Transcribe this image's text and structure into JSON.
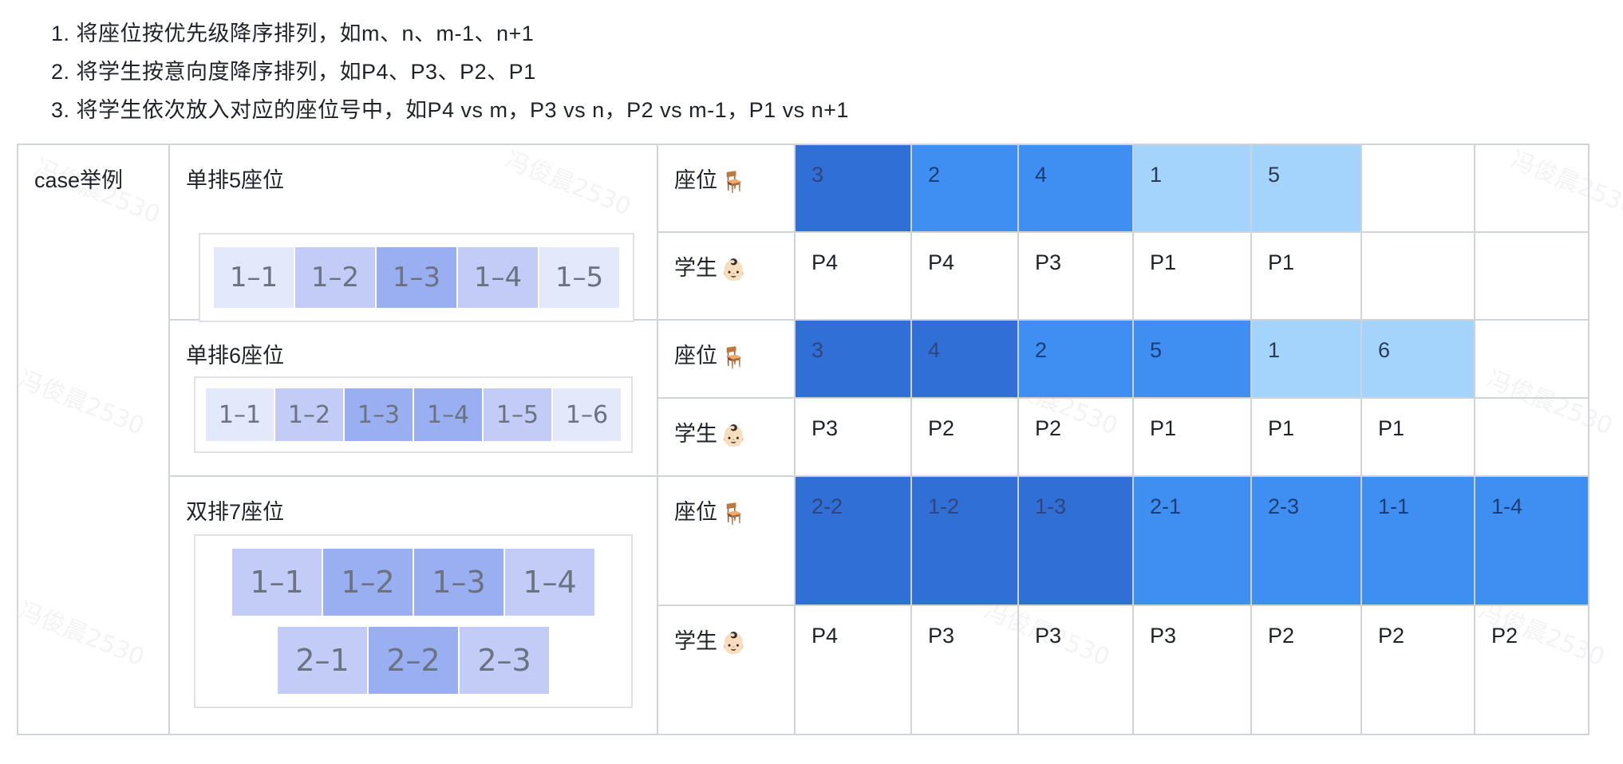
{
  "steps": [
    "1. 将座位按优先级降序排列，如m、n、m-1、n+1",
    "2. 将学生按意向度降序排列，如P4、P3、P2、P1",
    "3. 将学生依次放入对应的座位号中，如P4 vs m，P3 vs n，P2 vs m-1，P1 vs n+1"
  ],
  "watermark": "冯俊晨2530",
  "row_header": "case举例",
  "seat_label": "座位",
  "student_label": "学生",
  "seat_emoji": "🪑",
  "student_emoji": "👶🏻",
  "colors": {
    "seat_deep": "#2f6fd6",
    "seat_mid": "#3f8ff2",
    "seat_light": "#a4d3fb",
    "diagram_light": "#e4e8fb",
    "diagram_mid": "#c2ccf7",
    "diagram_dark": "#9aaef2"
  },
  "cases": [
    {
      "title": "单排5座位",
      "diagram_rows": [
        [
          {
            "label": "1–1",
            "level": 1
          },
          {
            "label": "1–2",
            "level": 2
          },
          {
            "label": "1–3",
            "level": 3
          },
          {
            "label": "1–4",
            "level": 2
          },
          {
            "label": "1–5",
            "level": 1
          }
        ]
      ],
      "seats": [
        {
          "label": "3",
          "shade": "deep"
        },
        {
          "label": "2",
          "shade": "mid"
        },
        {
          "label": "4",
          "shade": "mid"
        },
        {
          "label": "1",
          "shade": "light"
        },
        {
          "label": "5",
          "shade": "light"
        },
        {
          "label": "",
          "shade": "none"
        },
        {
          "label": "",
          "shade": "none"
        }
      ],
      "students": [
        "P4",
        "P4",
        "P3",
        "P1",
        "P1",
        "",
        ""
      ]
    },
    {
      "title": "单排6座位",
      "diagram_rows": [
        [
          {
            "label": "1–1",
            "level": 1
          },
          {
            "label": "1–2",
            "level": 2
          },
          {
            "label": "1–3",
            "level": 3
          },
          {
            "label": "1–4",
            "level": 3
          },
          {
            "label": "1–5",
            "level": 2
          },
          {
            "label": "1–6",
            "level": 1
          }
        ]
      ],
      "seats": [
        {
          "label": "3",
          "shade": "deep"
        },
        {
          "label": "4",
          "shade": "deep"
        },
        {
          "label": "2",
          "shade": "mid"
        },
        {
          "label": "5",
          "shade": "mid"
        },
        {
          "label": "1",
          "shade": "light"
        },
        {
          "label": "6",
          "shade": "light"
        },
        {
          "label": "",
          "shade": "none"
        }
      ],
      "students": [
        "P3",
        "P2",
        "P2",
        "P1",
        "P1",
        "P1",
        ""
      ]
    },
    {
      "title": "双排7座位",
      "diagram_rows": [
        [
          {
            "label": "1–1",
            "level": 2
          },
          {
            "label": "1–2",
            "level": 3
          },
          {
            "label": "1–3",
            "level": 3
          },
          {
            "label": "1–4",
            "level": 2
          }
        ],
        [
          {
            "label": "2–1",
            "level": 2
          },
          {
            "label": "2–2",
            "level": 3
          },
          {
            "label": "2–3",
            "level": 2
          }
        ]
      ],
      "seats": [
        {
          "label": "2-2",
          "shade": "deep"
        },
        {
          "label": "1-2",
          "shade": "deep"
        },
        {
          "label": "1-3",
          "shade": "deep"
        },
        {
          "label": "2-1",
          "shade": "mid"
        },
        {
          "label": "2-3",
          "shade": "mid"
        },
        {
          "label": "1-1",
          "shade": "mid"
        },
        {
          "label": "1-4",
          "shade": "mid"
        }
      ],
      "students": [
        "P4",
        "P3",
        "P3",
        "P3",
        "P2",
        "P2",
        "P2"
      ]
    }
  ]
}
